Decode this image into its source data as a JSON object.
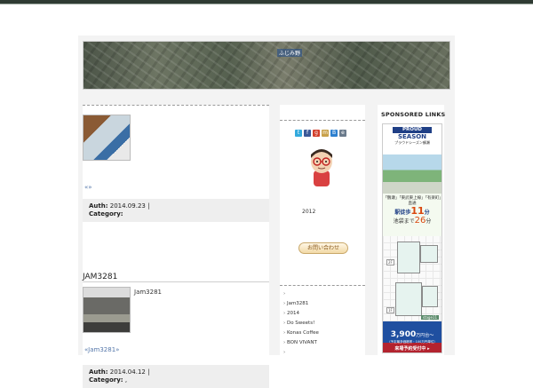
{
  "header": {
    "map_tag": "ふじみ野"
  },
  "main": {
    "pager_top": "«»",
    "post1": {
      "auth_label": "Auth:",
      "date": "2014.09.23 |",
      "category_label": "Category:"
    },
    "post2": {
      "title": "JAM3281",
      "caption": "Jam3281",
      "pager": "«Jam3281»",
      "auth_label": "Auth:",
      "date": "2014.04.12 |",
      "category_label": "Category:",
      "category_value": ","
    }
  },
  "sidebar": {
    "share_icons": [
      "twitter-icon",
      "facebook-icon",
      "google-plus-icon",
      "mixi-icon",
      "hatena-icon",
      "evernote-icon"
    ],
    "year": "2012",
    "contact_button": "お問い合わせ",
    "list": [
      "",
      "Jam3281",
      "2014",
      "Do Sweets!",
      "Konas Coffee",
      "BON VIVANT",
      ""
    ]
  },
  "sponsored": {
    "title": "SPONSORED LINKS",
    "ad": {
      "brand_top": "PROUD",
      "brand": "SEASON",
      "brand_sub": "プラウドシーズン鶴瀬",
      "stations": "「鶴瀬」「東武東上線」「有楽町」直通",
      "walk_label": "駅徒歩",
      "walk_min": "11",
      "walk_unit": "分",
      "ike_label": "池袋まで",
      "ike_min": "26",
      "ike_unit": "分",
      "floor1": "2F",
      "floor2": "1F",
      "stage": "stage11",
      "price": "3,900",
      "price_unit": "万円台～",
      "price_note": "（予定最多価格帯・100万円単位）",
      "cta": "来場予約受付中 ▸"
    }
  }
}
